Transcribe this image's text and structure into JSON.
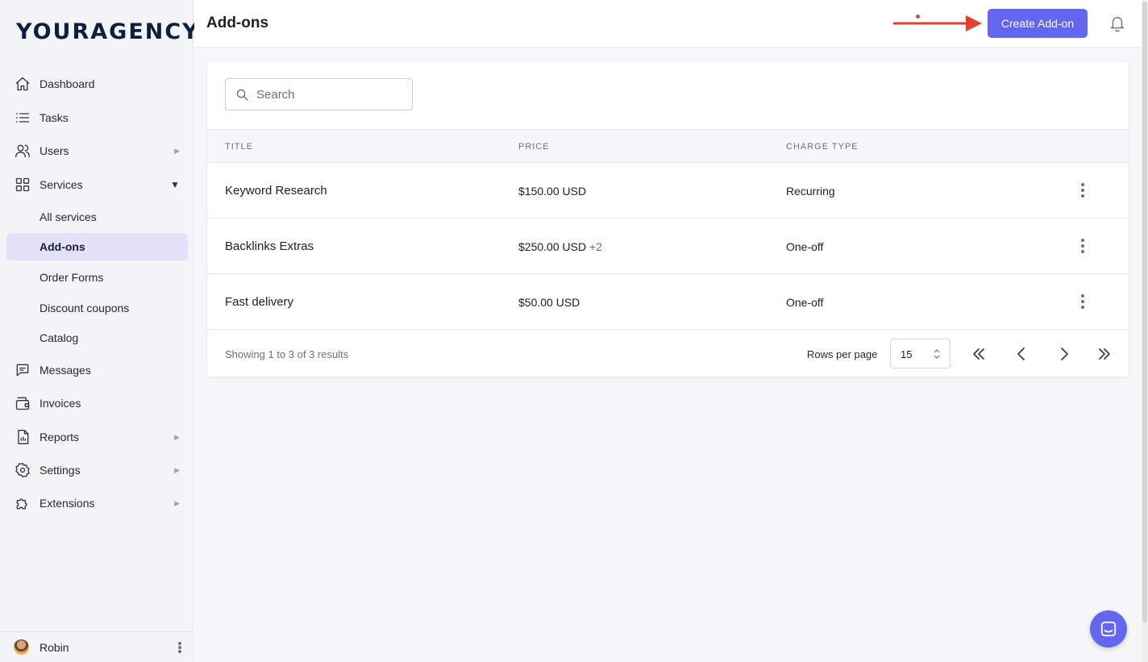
{
  "app": {
    "logo": "YOURAGENCY"
  },
  "sidebar": {
    "items": [
      {
        "label": "Dashboard",
        "icon": "home-icon"
      },
      {
        "label": "Tasks",
        "icon": "list-icon"
      },
      {
        "label": "Users",
        "icon": "users-icon",
        "caret": "▶"
      },
      {
        "label": "Services",
        "icon": "grid-icon",
        "caret": "▼"
      },
      {
        "label": "Messages",
        "icon": "message-icon"
      },
      {
        "label": "Invoices",
        "icon": "wallet-icon"
      },
      {
        "label": "Reports",
        "icon": "report-icon",
        "caret": "▶"
      },
      {
        "label": "Settings",
        "icon": "gear-icon",
        "caret": "▶"
      },
      {
        "label": "Extensions",
        "icon": "puzzle-icon",
        "caret": "▶"
      }
    ],
    "services_sub": [
      {
        "label": "All services"
      },
      {
        "label": "Add-ons",
        "active": true
      },
      {
        "label": "Order Forms"
      },
      {
        "label": "Discount coupons"
      },
      {
        "label": "Catalog"
      }
    ],
    "user": {
      "name": "Robin"
    }
  },
  "header": {
    "title": "Add-ons",
    "create_button": "Create Add-on"
  },
  "search": {
    "placeholder": "Search",
    "value": ""
  },
  "table": {
    "columns": [
      "TITLE",
      "PRICE",
      "CHARGE TYPE"
    ],
    "rows": [
      {
        "title": "Keyword Research",
        "price": "$150.00 USD",
        "price_extra": "",
        "charge_type": "Recurring"
      },
      {
        "title": "Backlinks Extras",
        "price": "$250.00 USD",
        "price_extra": "+2",
        "charge_type": "One-off"
      },
      {
        "title": "Fast delivery",
        "price": "$50.00 USD",
        "price_extra": "",
        "charge_type": "One-off"
      }
    ]
  },
  "pagination": {
    "info": "Showing 1 to 3 of 3 results",
    "rows_per_page_label": "Rows per page",
    "rows_per_page": "15"
  },
  "colors": {
    "accent": "#6366f1",
    "active_nav_bg": "#e1e2f7",
    "annotation_arrow": "#e2402e",
    "link": "#4f6fd6"
  }
}
